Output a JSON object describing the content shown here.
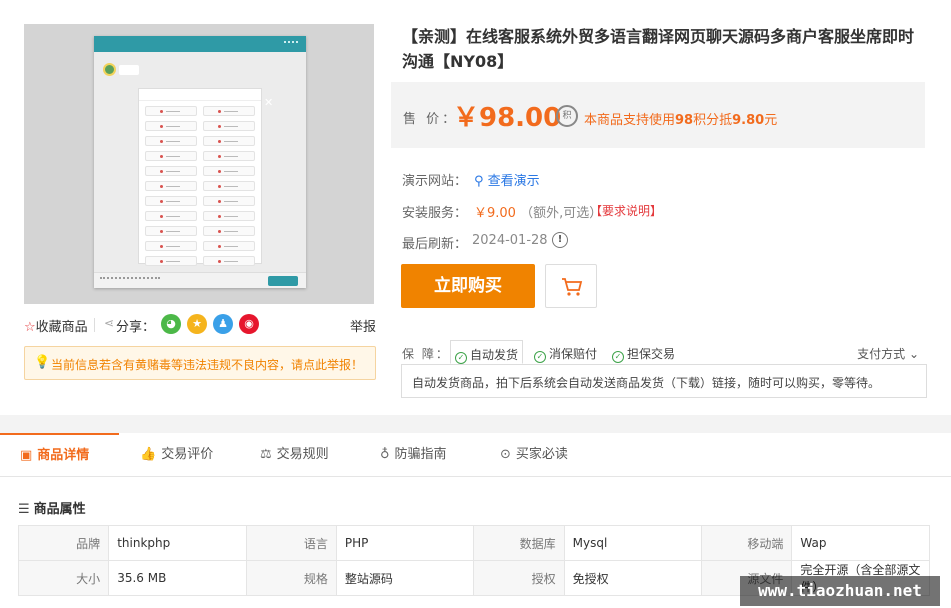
{
  "left": {
    "favorite_label": "收藏商品",
    "share_label": "分享：",
    "report_label": "举报",
    "warning_text": "当前信息若含有黄赌毒等违法违规不良内容，请点此举报！"
  },
  "product": {
    "title": "【亲测】在线客服系统外贸多语言翻译网页聊天源码多商户客服坐席即时沟通【NY08】",
    "price_label": "售 价：",
    "price": "￥98.00",
    "points_icon_text": "积",
    "points_text_pre": "本商品支持使用",
    "points_value": "98",
    "points_text_mid": "积分抵",
    "points_deduct": "9.80",
    "points_text_post": "元",
    "demo_label": "演示网站：",
    "demo_link": "查看演示",
    "service_label": "安装服务：",
    "service_price": "￥9.00",
    "service_note": "（额外,可选）",
    "service_request": "【要求说明】",
    "refresh_label": "最后刷新：",
    "refresh_date": "2024-01-28",
    "buy_label": "立即购买"
  },
  "guarantee": {
    "label": "保 障：",
    "items": [
      "自动发货",
      "消保赔付",
      "担保交易"
    ],
    "pay_method": "支付方式",
    "description": "自动发货商品，拍下后系统会自动发送商品发货（下载）链接，随时可以购买，零等待。"
  },
  "tabs": [
    "商品详情",
    "交易评价",
    "交易规则",
    "防骗指南",
    "买家必读"
  ],
  "attributes": {
    "heading": "商品属性",
    "rows": [
      [
        [
          "品牌",
          "thinkphp"
        ],
        [
          "语言",
          "PHP"
        ],
        [
          "数据库",
          "Mysql"
        ],
        [
          "移动端",
          "Wap"
        ]
      ],
      [
        [
          "大小",
          "35.6 MB"
        ],
        [
          "规格",
          "整站源码"
        ],
        [
          "授权",
          "免授权"
        ],
        [
          "源文件",
          "完全开源（含全部源文件）"
        ]
      ]
    ]
  },
  "watermark": "www.tiaozhuan.net",
  "colors": {
    "accent": "#f26b1d",
    "buy_button": "#f08300",
    "link": "#2b78e4"
  }
}
